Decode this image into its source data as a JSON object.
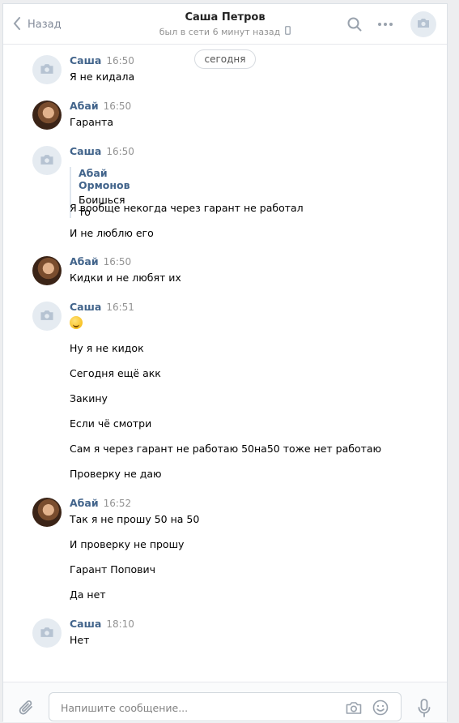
{
  "header": {
    "back_label": "Назад",
    "contact_name": "Саша Петров",
    "status": "был в сети 6 минут назад"
  },
  "date_divider": "сегодня",
  "messages": [
    {
      "author": "Саша",
      "time": "16:50",
      "lines": [
        "Я не кидала"
      ]
    },
    {
      "author": "Абай",
      "time": "16:50",
      "lines": [
        "Гаранта"
      ]
    },
    {
      "author": "Саша",
      "time": "16:50",
      "quote": {
        "author": "Абай Ормонов",
        "text": "Боишься то"
      },
      "lines": [
        "Я вообще некогда через гарант не работал",
        "И не люблю его"
      ]
    },
    {
      "author": "Абай",
      "time": "16:50",
      "lines": [
        "Кидки и не любят их"
      ]
    },
    {
      "author": "Саша",
      "time": "16:51",
      "emoji": "rolling-laughing-emoji",
      "lines": [
        "Ну я не кидок",
        "Сегодня ещё акк",
        "Закину",
        "Если чё смотри",
        "Сам я через гарант не работаю 50на50 тоже нет работаю",
        "Проверку не даю"
      ]
    },
    {
      "author": "Абай",
      "time": "16:52",
      "lines": [
        "Так я не прошу 50 на 50",
        "И проверку не прошу",
        "Гарант Попович",
        "Да нет"
      ]
    },
    {
      "author": "Саша",
      "time": "18:10",
      "lines": [
        "Нет"
      ]
    }
  ],
  "composer": {
    "placeholder": "Напишите сообщение..."
  },
  "colors": {
    "author": "#42648b",
    "accent": "#5181b8",
    "icon_gray": "#99a2ad"
  }
}
